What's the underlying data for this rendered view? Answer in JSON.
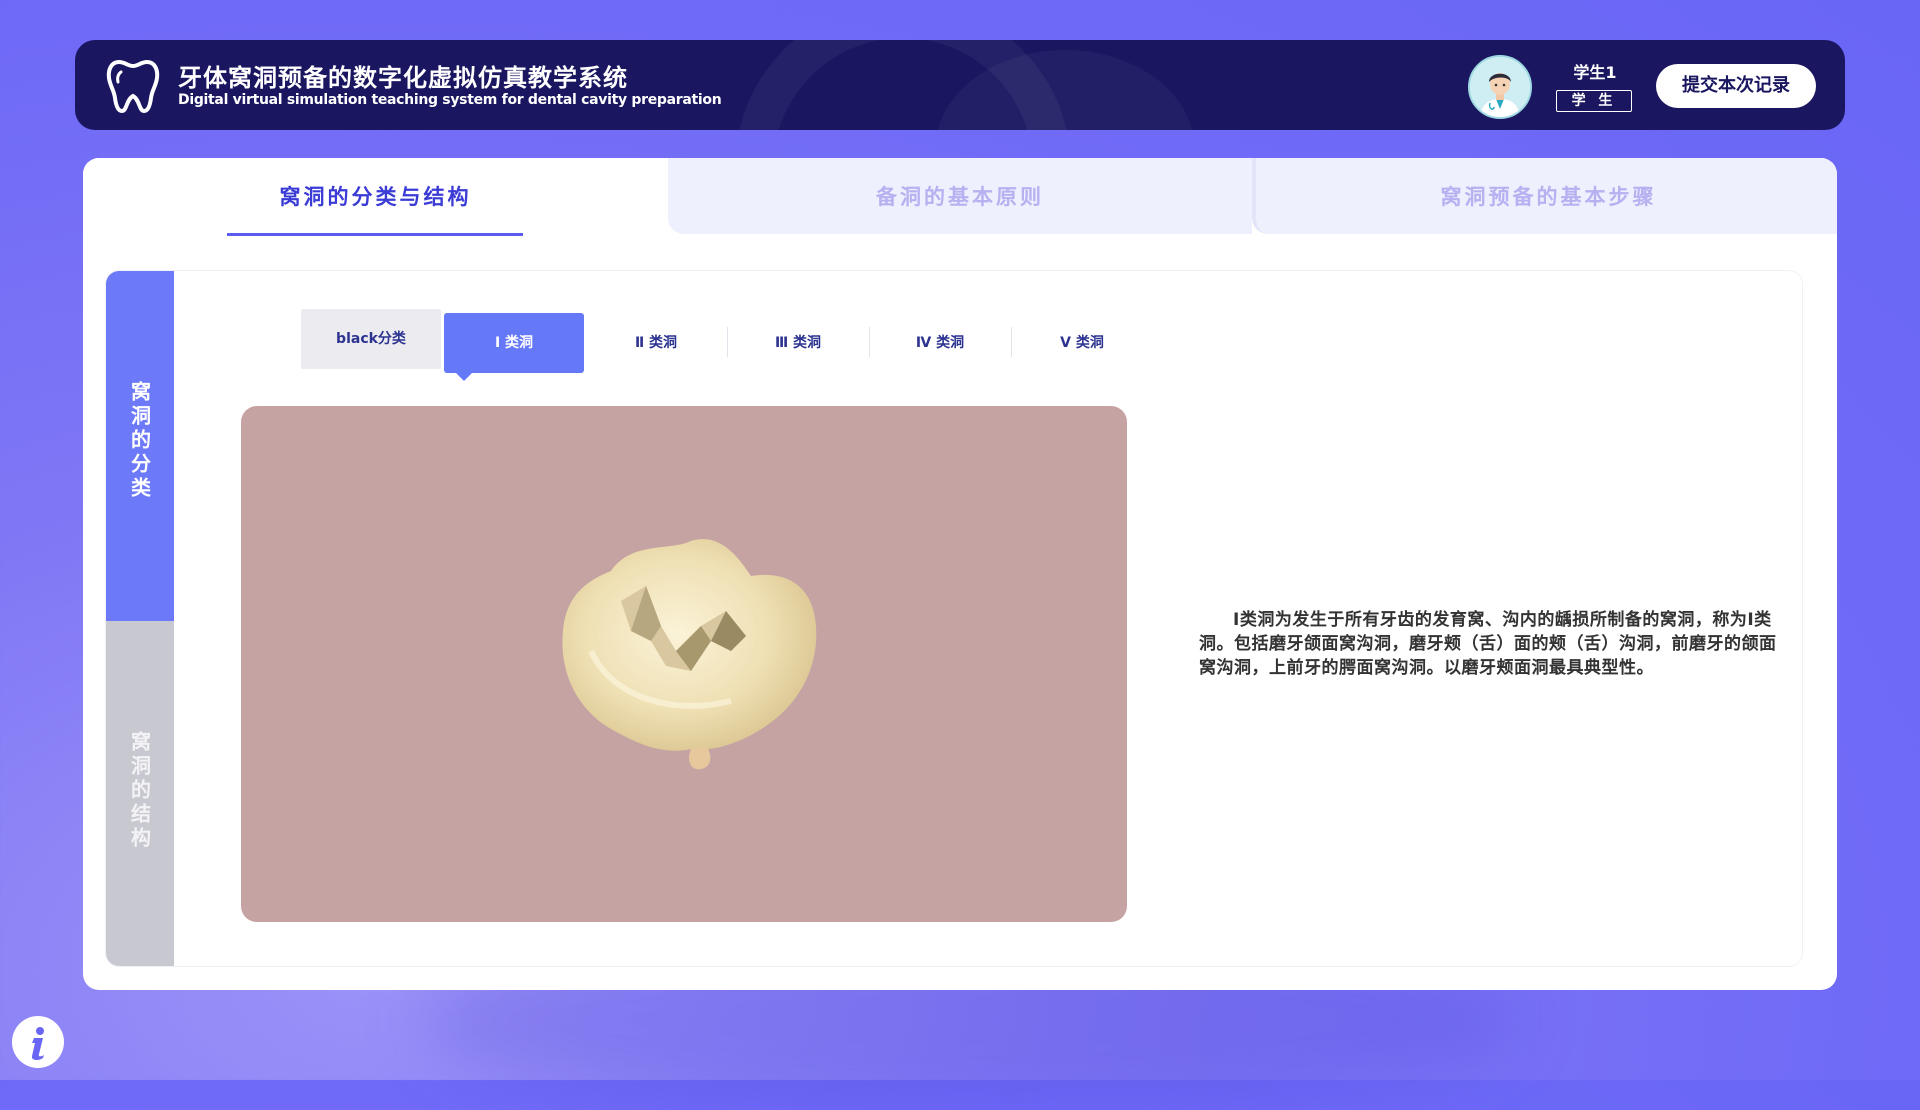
{
  "app": {
    "title_cn": "牙体窝洞预备的数字化虚拟仿真教学系统",
    "title_en": "Digital virtual simulation teaching system for dental cavity preparation"
  },
  "user": {
    "name": "学生1",
    "role": "学 生",
    "submit_label": "提交本次记录"
  },
  "main_tabs": [
    {
      "label": "窝洞的分类与结构",
      "active": true
    },
    {
      "label": "备洞的基本原则",
      "active": false
    },
    {
      "label": "窝洞预备的基本步骤",
      "active": false
    }
  ],
  "side_nav": [
    {
      "label": "窝洞的分类",
      "active": true
    },
    {
      "label": "窝洞的结构",
      "active": false
    }
  ],
  "sub_tabs": {
    "classification_label": "black分类",
    "items": [
      {
        "label": "Ⅰ 类洞",
        "active": true
      },
      {
        "label": "Ⅱ 类洞",
        "active": false
      },
      {
        "label": "Ⅲ 类洞",
        "active": false
      },
      {
        "label": "Ⅳ 类洞",
        "active": false
      },
      {
        "label": "Ⅴ 类洞",
        "active": false
      }
    ]
  },
  "description": "Ⅰ类洞为发生于所有牙齿的发育窝、沟内的龋损所制备的窝洞，称为Ⅰ类洞。包括磨牙颌面窝沟洞，磨牙颊（舌）面的颊（舌）沟洞，前磨牙的颌面窝沟洞，上前牙的腭面窝沟洞。以磨牙颊面洞最具典型性。",
  "icons": {
    "logo": "tooth-logo-icon",
    "info": "info-icon"
  },
  "colors": {
    "header_bg": "#1a1660",
    "accent": "#6578f7",
    "viewer_bg": "#c5a3a3"
  }
}
